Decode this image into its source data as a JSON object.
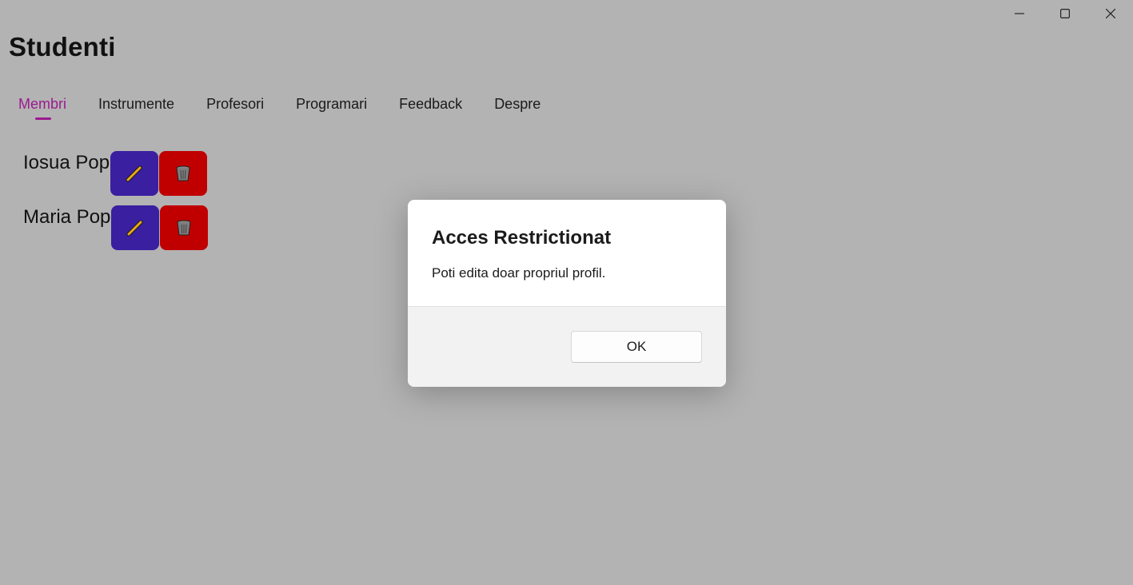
{
  "app": {
    "title": "Studenti"
  },
  "window_controls": {
    "minimize_icon": "minimize-icon",
    "maximize_icon": "maximize-icon",
    "close_icon": "close-icon"
  },
  "tabs": [
    {
      "label": "Membri",
      "active": true
    },
    {
      "label": "Instrumente",
      "active": false
    },
    {
      "label": "Profesori",
      "active": false
    },
    {
      "label": "Programari",
      "active": false
    },
    {
      "label": "Feedback",
      "active": false
    },
    {
      "label": "Despre",
      "active": false
    }
  ],
  "members": [
    {
      "name": "Iosua Pop",
      "edit_icon": "pencil-icon",
      "delete_icon": "trash-icon"
    },
    {
      "name": "Maria Pop",
      "edit_icon": "pencil-icon",
      "delete_icon": "trash-icon"
    }
  ],
  "dialog": {
    "title": "Acces Restrictionat",
    "message": "Poti edita doar propriul profil.",
    "ok_label": "OK"
  },
  "colors": {
    "accent": "#9b1a8f",
    "edit_button": "#3a1fa0",
    "delete_button": "#c00000",
    "overlay_background": "#b3b3b3"
  }
}
